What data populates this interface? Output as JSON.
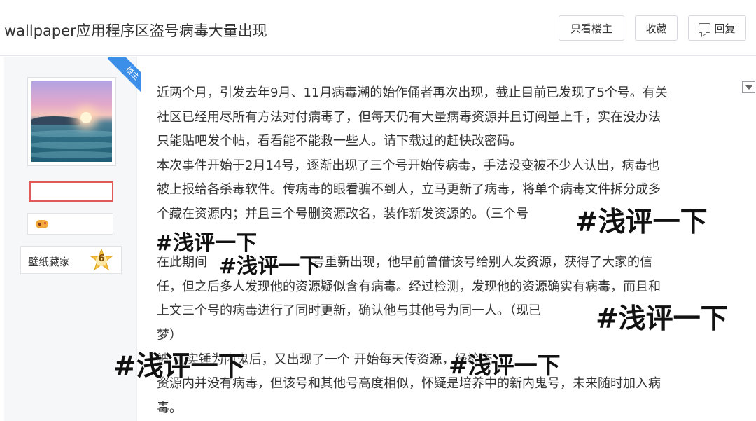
{
  "header": {
    "title": "wallpaper应用程序区盗号病毒大量出现",
    "only_op_label": "只看楼主",
    "favorite_label": "收藏",
    "reply_label": "回复"
  },
  "author": {
    "op_tag": "楼主",
    "level_title": "壁纸藏家",
    "level": "6"
  },
  "post": {
    "lines": [
      "近两个月，引发去年9月、11月病毒潮的始作俑者再次出现，截止目前已发现了5个号。有关",
      "社区已经用尽所有方法对付病毒了，但每天仍有大量病毒资源并且订阅量上千，实在没办法",
      "只能贴吧发个帖，看看能不能救一些人。请下载过的赶快改密码。",
      "本次事件开始于2月14号，逐渐出现了三个号开始传病毒，手法没变被不少人认出，病毒也",
      "被上报给各杀毒软件。传病毒的眼看骗不到人，立马更新了病毒，将单个病毒文件拆分成多",
      "个藏在资源内；并且三个号删资源改名，装作新发资源的。（三个号",
      "在此期间",
      "任，但之后多人发现他的资源疑似含有病毒。经过检测，发现他的资源确实有病毒，而且和",
      "上文三个号的病毒进行了同时更新，确认他与其他号为同一人。（现已",
      "梦）",
      "被 区实锤为内鬼后，又出现了一个 开始每天传资源，经检查",
      "资源内并没有病毒，但该号和其他号高度相似，怀疑是培养中的新内鬼号，未来随时加入病",
      "毒。"
    ],
    "partial": {
      "line8_tail": "号重新出现，他早前曾借该号给别人发资源，获得了大家的信"
    }
  },
  "watermark": {
    "text": "#浅评一下"
  }
}
